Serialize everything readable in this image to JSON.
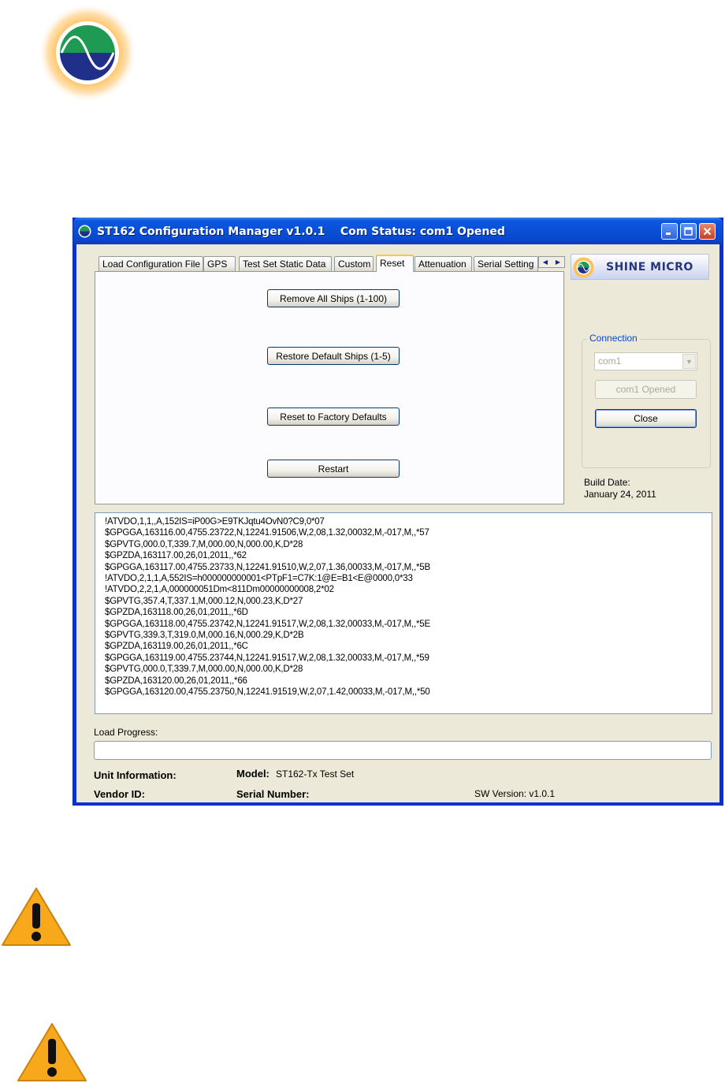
{
  "window": {
    "title": "ST162 Configuration Manager v1.0.1    Com Status: com1 Opened"
  },
  "tabs": [
    {
      "label": "Load Configuration File",
      "active": false
    },
    {
      "label": "GPS",
      "active": false
    },
    {
      "label": "Test Set Static Data",
      "active": false
    },
    {
      "label": "Custom",
      "active": false
    },
    {
      "label": "Reset",
      "active": true
    },
    {
      "label": "Attenuation",
      "active": false
    },
    {
      "label": "Serial Setting",
      "active": false
    }
  ],
  "reset_panel": {
    "remove_all_ships": "Remove All Ships (1-100)",
    "restore_default_ships": "Restore Default Ships (1-5)",
    "reset_factory_defaults": "Reset to Factory Defaults",
    "restart": "Restart"
  },
  "brand": {
    "name": "SHINE MICRO"
  },
  "connection": {
    "group_label": "Connection",
    "port_value": "com1",
    "opened_label": "com1 Opened",
    "close_label": "Close"
  },
  "build": {
    "label": "Build Date:",
    "date": "January 24, 2011"
  },
  "log": {
    "lines": [
      "!ATVDO,1,1,,A,152IS=iP00G>E9TKJqtu4OvN0?C9,0*07",
      "$GPGGA,163116.00,4755.23722,N,12241.91506,W,2,08,1.32,00032,M,-017,M,,*57",
      "$GPVTG,000.0,T,339.7,M,000.00,N,000.00,K,D*28",
      "$GPZDA,163117.00,26,01,2011,,*62",
      "$GPGGA,163117.00,4755.23733,N,12241.91510,W,2,07,1.36,00033,M,-017,M,,*5B",
      "!ATVDO,2,1,1,A,552IS=h000000000001<PTpF1=C7K:1@E=B1<E@0000,0*33",
      "!ATVDO,2,2,1,A,000000051Dm<811Dm00000000008,2*02",
      "$GPVTG,357.4,T,337.1,M,000.12,N,000.23,K,D*27",
      "$GPZDA,163118.00,26,01,2011,,*6D",
      "$GPGGA,163118.00,4755.23742,N,12241.91517,W,2,08,1.32,00033,M,-017,M,,*5E",
      "$GPVTG,339.3,T,319.0,M,000.16,N,000.29,K,D*2B",
      "$GPZDA,163119.00,26,01,2011,,*6C",
      "$GPGGA,163119.00,4755.23744,N,12241.91517,W,2,08,1.32,00033,M,-017,M,,*59",
      "$GPVTG,000.0,T,339.7,M,000.00,N,000.00,K,D*28",
      "$GPZDA,163120.00,26,01,2011,,*66",
      "$GPGGA,163120.00,4755.23750,N,12241.91519,W,2,07,1.42,00033,M,-017,M,,*50"
    ]
  },
  "progress": {
    "label": "Load Progress:",
    "value": 0
  },
  "unit_info": {
    "label": "Unit Information:",
    "model_label": "Model:",
    "model_value": "ST162-Tx Test Set",
    "vendor_label": "Vendor ID:",
    "serial_label": "Serial Number:",
    "sw_version": "SW Version: v1.0.1"
  },
  "colors": {
    "titlebar": "#0a4fd6",
    "active_tab_accent": "#ffc83c",
    "group_label": "#0046d5",
    "brand_text": "#28357f",
    "warning": "#f7a81b"
  },
  "icons": [
    "shine-micro-logo-icon",
    "app-icon",
    "minimize-icon",
    "maximize-icon",
    "close-icon",
    "warning-icon"
  ]
}
